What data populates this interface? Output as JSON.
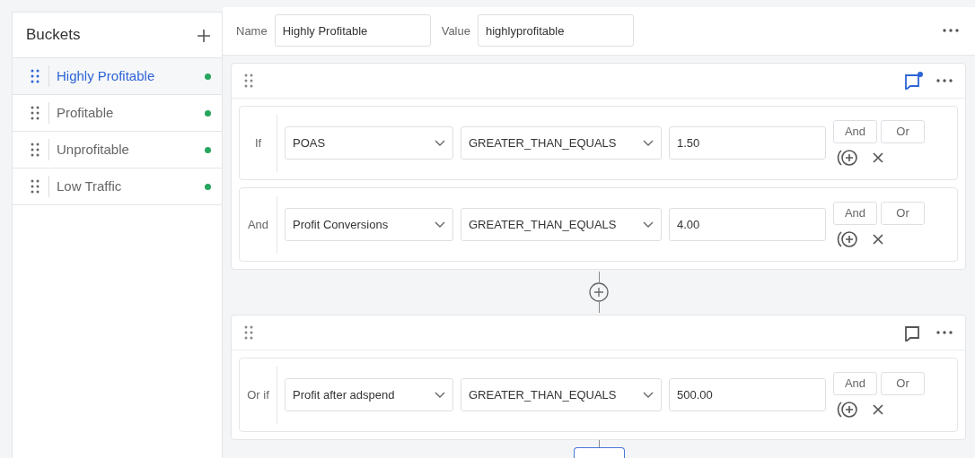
{
  "sidebar": {
    "title": "Buckets",
    "items": [
      {
        "label": "Highly Profitable",
        "selected": true,
        "color": "#28a55f"
      },
      {
        "label": "Profitable",
        "selected": false,
        "color": "#28a55f"
      },
      {
        "label": "Unprofitable",
        "selected": false,
        "color": "#28a55f"
      },
      {
        "label": "Low Traffic",
        "selected": false,
        "color": "#28a55f"
      }
    ]
  },
  "header": {
    "name_label": "Name",
    "name_value": "Highly Profitable",
    "value_label": "Value",
    "value_value": "highlyprofitable"
  },
  "groups": [
    {
      "comment_unread": true,
      "rows": [
        {
          "connector": "If",
          "field": "POAS",
          "operator": "GREATER_THAN_EQUALS",
          "value": "1.50",
          "buttons": [
            "And",
            "Or"
          ]
        },
        {
          "connector": "And",
          "field": "Profit Conversions",
          "operator": "GREATER_THAN_EQUALS",
          "value": "4.00",
          "buttons": [
            "And",
            "Or"
          ]
        }
      ]
    },
    {
      "comment_unread": false,
      "rows": [
        {
          "connector": "Or if",
          "field": "Profit after adspend",
          "operator": "GREATER_THAN_EQUALS",
          "value": "500.00",
          "buttons": [
            "And",
            "Or"
          ]
        }
      ]
    }
  ]
}
